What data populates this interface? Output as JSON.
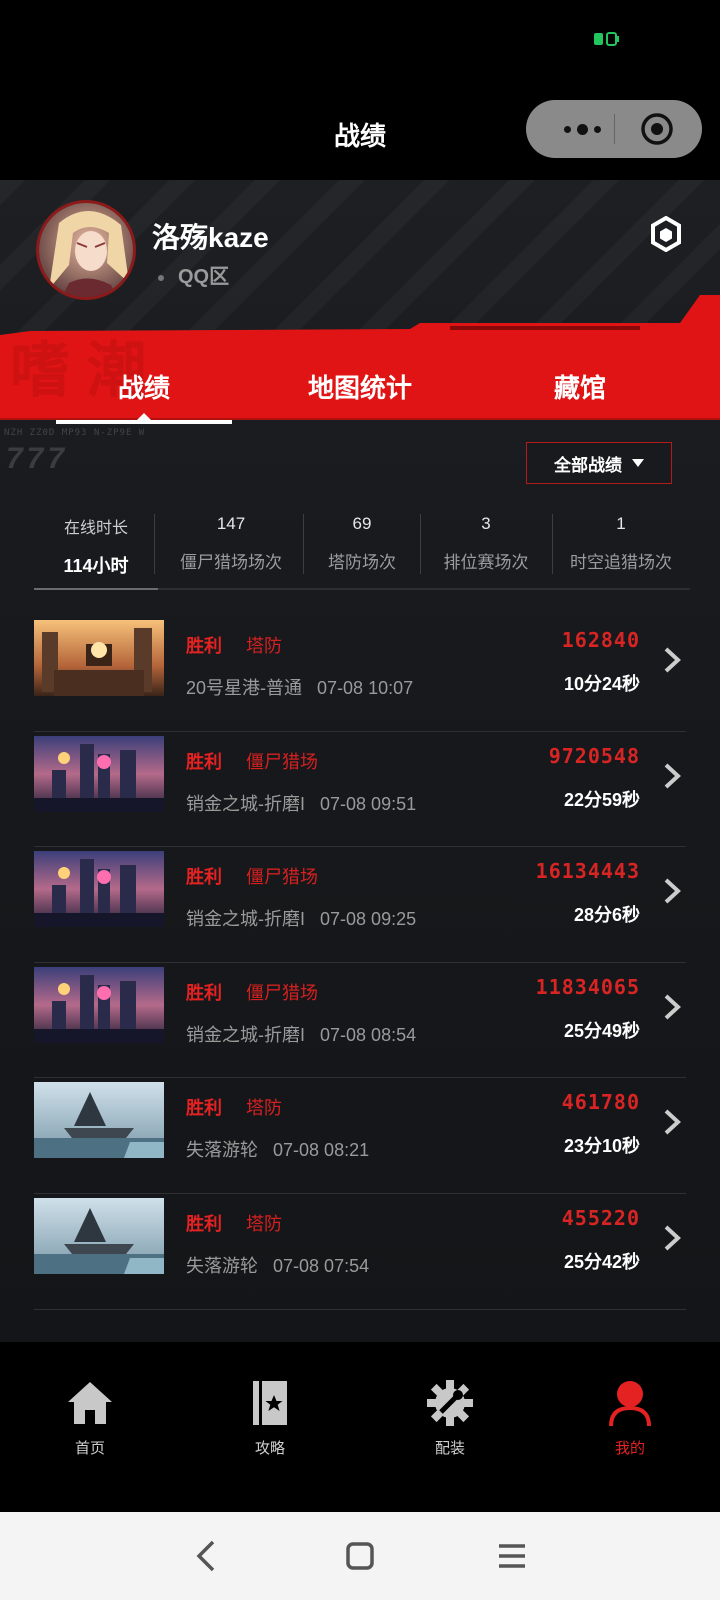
{
  "header": {
    "title": "战绩",
    "capsule_more_icon": "more-dots-icon",
    "capsule_close_icon": "target-icon"
  },
  "profile": {
    "username": "洛殇kaze",
    "server": "QQ区",
    "settings_icon": "hex-settings-icon"
  },
  "tabs": [
    {
      "label": "战绩",
      "active": true
    },
    {
      "label": "地图统计",
      "active": false
    },
    {
      "label": "藏馆",
      "active": false
    }
  ],
  "filter": {
    "label": "全部战绩"
  },
  "stats": {
    "online_label": "在线时长",
    "online_value": "114小时",
    "items": [
      {
        "value": "147",
        "label": "僵尸猎场场次"
      },
      {
        "value": "69",
        "label": "塔防场次"
      },
      {
        "value": "3",
        "label": "排位赛场次"
      },
      {
        "value": "1",
        "label": "时空追猎场次"
      }
    ]
  },
  "matches": [
    {
      "result": "胜利",
      "mode": "塔防",
      "map": "20号星港-普通",
      "time": "07-08 10:07",
      "score": "162840",
      "duration": "10分24秒",
      "thumb": "sunset"
    },
    {
      "result": "胜利",
      "mode": "僵尸猎场",
      "map": "销金之城-折磨I",
      "time": "07-08 09:51",
      "score": "9720548",
      "duration": "22分59秒",
      "thumb": "city"
    },
    {
      "result": "胜利",
      "mode": "僵尸猎场",
      "map": "销金之城-折磨I",
      "time": "07-08 09:25",
      "score": "16134443",
      "duration": "28分6秒",
      "thumb": "city"
    },
    {
      "result": "胜利",
      "mode": "僵尸猎场",
      "map": "销金之城-折磨I",
      "time": "07-08 08:54",
      "score": "11834065",
      "duration": "25分49秒",
      "thumb": "city"
    },
    {
      "result": "胜利",
      "mode": "塔防",
      "map": "失落游轮",
      "time": "07-08 08:21",
      "score": "461780",
      "duration": "23分10秒",
      "thumb": "ship"
    },
    {
      "result": "胜利",
      "mode": "塔防",
      "map": "失落游轮",
      "time": "07-08 07:54",
      "score": "455220",
      "duration": "25分42秒",
      "thumb": "ship"
    }
  ],
  "bottom_nav": [
    {
      "label": "首页",
      "icon": "home-icon",
      "active": false
    },
    {
      "label": "攻略",
      "icon": "guide-book-icon",
      "active": false
    },
    {
      "label": "配装",
      "icon": "wrench-gear-icon",
      "active": false
    },
    {
      "label": "我的",
      "icon": "user-icon",
      "active": true
    }
  ],
  "colors": {
    "accent": "#e52222",
    "band": "#e01414",
    "bg": "#17191c"
  }
}
